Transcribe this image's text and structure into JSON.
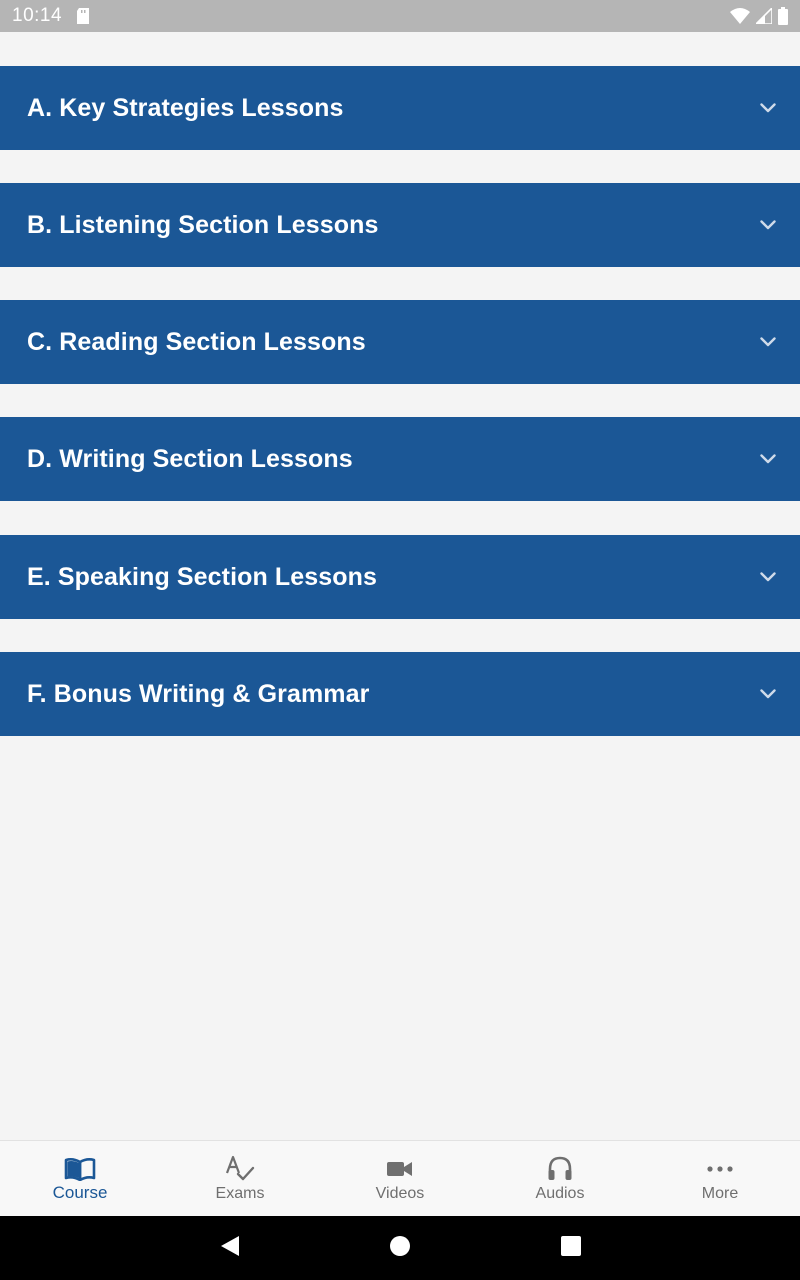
{
  "status_bar": {
    "time": "10:14",
    "icons": [
      "sd-card-icon",
      "wifi-icon",
      "signal-icon",
      "battery-icon"
    ]
  },
  "sections": [
    {
      "label": "A. Key Strategies Lessons"
    },
    {
      "label": "B. Listening Section Lessons"
    },
    {
      "label": "C. Reading Section Lessons"
    },
    {
      "label": "D. Writing Section Lessons"
    },
    {
      "label": "E. Speaking Section Lessons"
    },
    {
      "label": "F. Bonus Writing & Grammar"
    }
  ],
  "tabs": [
    {
      "label": "Course",
      "icon": "book-icon",
      "active": true
    },
    {
      "label": "Exams",
      "icon": "spellcheck-icon",
      "active": false
    },
    {
      "label": "Videos",
      "icon": "video-camera-icon",
      "active": false
    },
    {
      "label": "Audios",
      "icon": "headphones-icon",
      "active": false
    },
    {
      "label": "More",
      "icon": "more-dots-icon",
      "active": false
    }
  ],
  "colors": {
    "primary": "#1b5796",
    "background": "#f4f4f4",
    "status_bar": "#b5b5b5",
    "tab_inactive": "#6f6f6f"
  }
}
